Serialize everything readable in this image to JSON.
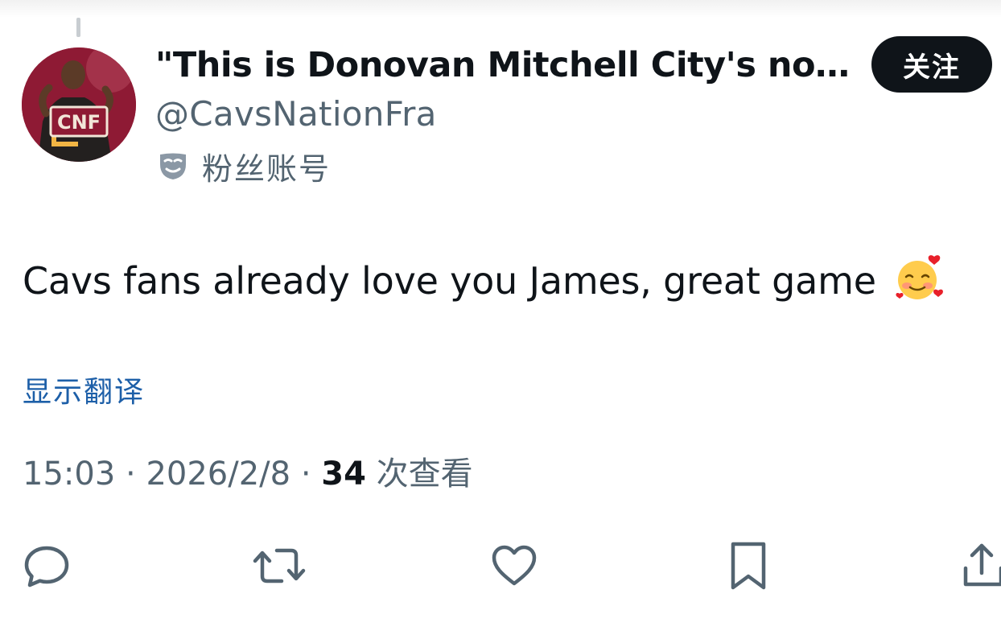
{
  "tweet": {
    "display_name": "\"This is Donovan Mitchell City's now...",
    "handle": "@CavsNationFra",
    "account_label": "粉丝账号",
    "follow_label": "关注",
    "avatar_text": "CNF",
    "text": "Cavs fans already love you James, great game",
    "emoji": "smiling-face-with-hearts",
    "translate_label": "显示翻译",
    "time": "15:03",
    "date": "2026/2/8",
    "views_count": "34",
    "views_label": "次查看",
    "separator": "·"
  },
  "actions": [
    {
      "name": "reply",
      "icon": "reply-icon"
    },
    {
      "name": "retweet",
      "icon": "retweet-icon"
    },
    {
      "name": "like",
      "icon": "heart-icon"
    },
    {
      "name": "bookmark",
      "icon": "bookmark-icon"
    },
    {
      "name": "share",
      "icon": "share-icon"
    }
  ],
  "colors": {
    "primary_text": "#0f1419",
    "secondary_text": "#536471",
    "link": "#1d5fa8",
    "follow_button_bg": "#0f1419",
    "icon": "#536471"
  }
}
